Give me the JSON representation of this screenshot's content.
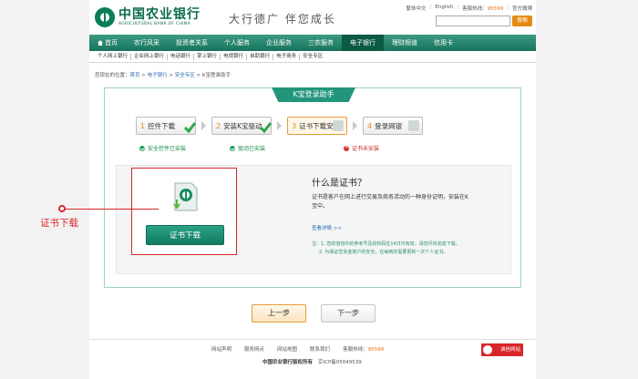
{
  "header": {
    "bank_name": "中国农业银行",
    "bank_name_en": "AGRICULTURAL BANK OF CHINA",
    "slogan": "大行德广  伴您成长",
    "toplinks": [
      "繁体中文",
      "English",
      "客服热线：",
      "95599",
      "官方微博"
    ],
    "search_placeholder": "",
    "search_button": "搜索"
  },
  "nav": {
    "items": [
      "首页",
      "农行风采",
      "投资者关系",
      "个人服务",
      "企业服务",
      "三农服务",
      "电子银行",
      "理财频道",
      "信用卡"
    ],
    "active": "电子银行"
  },
  "subnav": {
    "items": [
      "个人网上银行",
      "企业网上银行",
      "电话银行",
      "掌上银行",
      "电视银行",
      "自助银行",
      "电子商务",
      "安全专区"
    ]
  },
  "breadcrumb": {
    "prefix": "您现在的位置：",
    "items": [
      "首页",
      "电子银行",
      "安全专区",
      "K宝登录助手"
    ],
    "sep": " > "
  },
  "panel": {
    "title": "K宝登录助手",
    "steps": [
      {
        "num": "1",
        "label": "控件下载",
        "status": "安全控件已安装",
        "state": "ok"
      },
      {
        "num": "2",
        "label": "安装K宝驱动",
        "status": "驱动已安装",
        "state": "ok"
      },
      {
        "num": "3",
        "label": "证书下载安装",
        "status": "证书未安装",
        "state": "error"
      },
      {
        "num": "4",
        "label": "登录网银",
        "status": "",
        "state": "none"
      }
    ],
    "download_button": "证书下载",
    "info_title": "什么是证书？",
    "info_text": "证书是客户在网上进行交易及商务活动的一种身份证明，安装在K宝中。",
    "info_more": "查看详情 >>",
    "info_notes": [
      "注：1. 您的值班中的参考号及授权码在14日内有效，请您尽快完成下载。",
      "2. 为保证您资金账户的安全，在每两年需要更新一次个人证书。"
    ]
  },
  "callout": {
    "label": "证书下载"
  },
  "buttons": {
    "prev": "上一步",
    "next": "下一步"
  },
  "footer": {
    "links": [
      "网站声明",
      "服务网点",
      "网站地图",
      "联系我们",
      "客服热线：",
      "95599"
    ],
    "copyright": "中国农业银行版权所有",
    "icp": "京ICP备05049539",
    "badge": "诚信网站"
  },
  "colors": {
    "brand_green": "#17735c",
    "accent_orange": "#e58a14",
    "alert_red": "#d8262a"
  }
}
